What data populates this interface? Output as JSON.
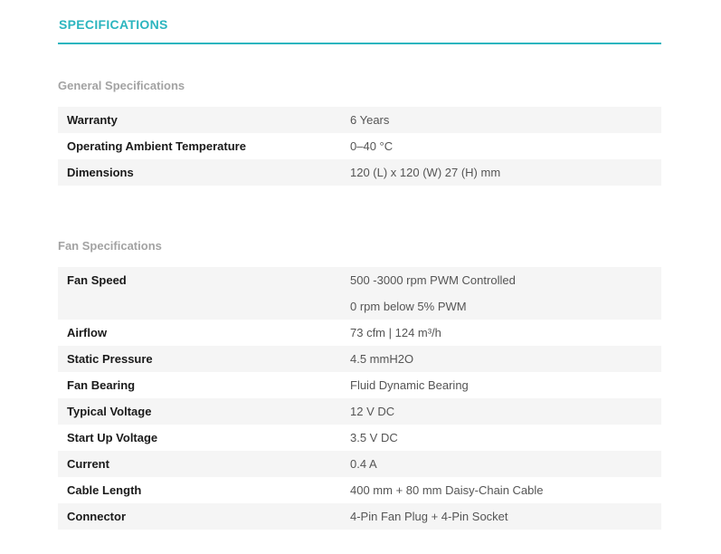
{
  "page_title": "SPECIFICATIONS",
  "general": {
    "heading": "General Specifications",
    "rows": [
      {
        "label": "Warranty",
        "values": [
          "6 Years"
        ]
      },
      {
        "label": "Operating Ambient Temperature",
        "values": [
          "0–40 °C"
        ]
      },
      {
        "label": "Dimensions",
        "values": [
          "120 (L) x 120 (W) 27 (H) mm"
        ]
      }
    ]
  },
  "fan": {
    "heading": "Fan Specifications",
    "rows": [
      {
        "label": "Fan Speed",
        "values": [
          "500 -3000 rpm PWM Controlled",
          "0 rpm below 5% PWM"
        ]
      },
      {
        "label": "Airflow",
        "values": [
          "73 cfm | 124 m³/h"
        ]
      },
      {
        "label": "Static Pressure",
        "values": [
          "4.5 mmH2O"
        ]
      },
      {
        "label": "Fan Bearing",
        "values": [
          "Fluid Dynamic Bearing"
        ]
      },
      {
        "label": "Typical Voltage",
        "values": [
          "12 V DC"
        ]
      },
      {
        "label": "Start Up Voltage",
        "values": [
          "3.5 V DC"
        ]
      },
      {
        "label": "Current",
        "values": [
          "0.4 A"
        ]
      },
      {
        "label": "Cable Length",
        "values": [
          "400 mm + 80 mm Daisy-Chain Cable"
        ]
      },
      {
        "label": "Connector",
        "values": [
          "4-Pin Fan Plug + 4-Pin Socket"
        ]
      }
    ]
  }
}
